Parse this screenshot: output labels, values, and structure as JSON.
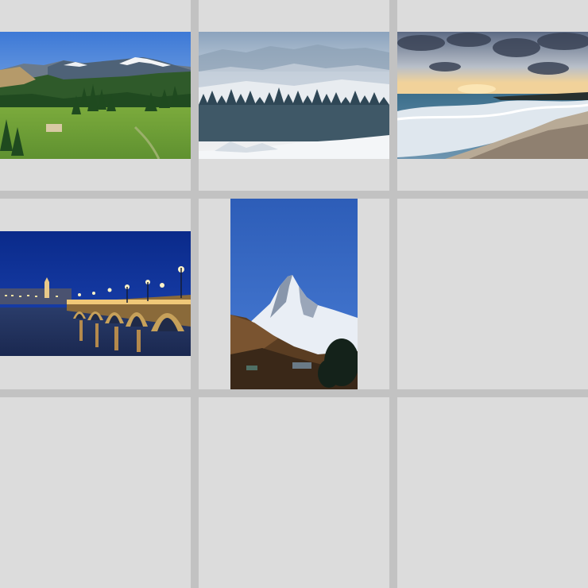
{
  "gallery": {
    "cells": [
      {
        "icon": "mountain-meadow-photo"
      },
      {
        "icon": "misty-forest-photo"
      },
      {
        "icon": "beach-sunset-photo"
      },
      {
        "icon": "night-bridge-photo"
      },
      {
        "icon": "snowy-peak-photo"
      },
      {
        "icon": "empty"
      },
      {
        "icon": "empty"
      },
      {
        "icon": "empty"
      },
      {
        "icon": "empty"
      }
    ]
  }
}
